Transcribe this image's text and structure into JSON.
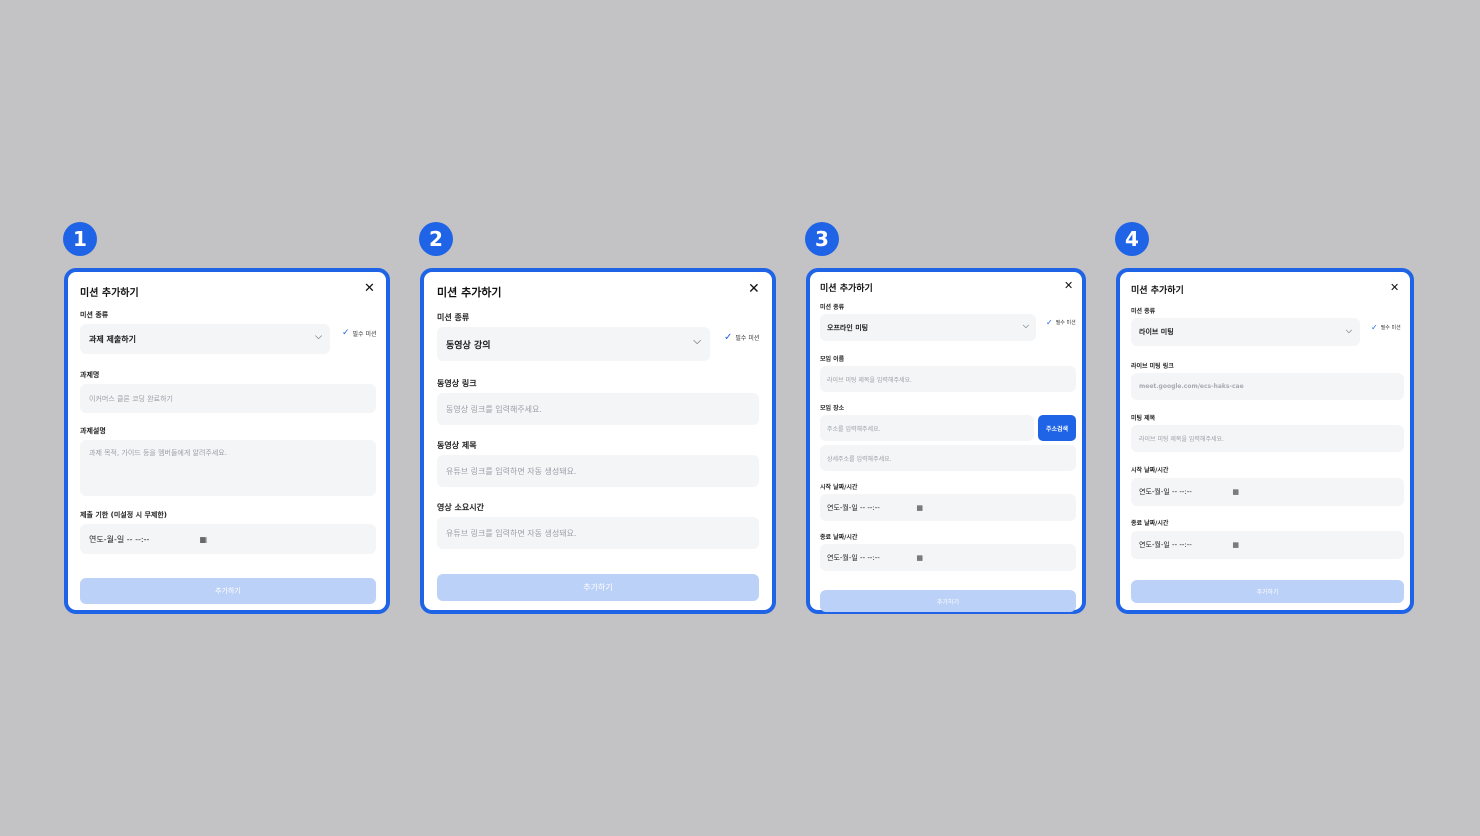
{
  "colors": {
    "accent": "#1f63e6",
    "button_disabled": "#bcd1f7",
    "field_bg": "#f4f5f7",
    "canvas": "#c3c3c5"
  },
  "common": {
    "title": "미션 추가하기",
    "mission_type_label": "미션 종류",
    "required_label": "필수 미션",
    "add_button": "추가하기",
    "datetime_value": "연도-월-일 -- --:--",
    "close_icon": "close-icon",
    "calendar_icon": "calendar-icon"
  },
  "panels": [
    {
      "number": "1",
      "mission_type": "과제 제출하기",
      "fields": [
        {
          "label": "과제명",
          "placeholder": "이커머스 클론 코딩 완료하기"
        },
        {
          "label": "과제설명",
          "placeholder": "과제 목적, 가이드 등을 멤버들에게 알려주세요."
        },
        {
          "label": "제출 기한 (미설정 시 무제한)"
        }
      ]
    },
    {
      "number": "2",
      "mission_type": "동영상 강의",
      "fields": [
        {
          "label": "동영상 링크",
          "placeholder": "동영상 링크를 입력해주세요."
        },
        {
          "label": "동영상 제목",
          "placeholder": "유튜브 링크를 입력하면 자동 생성돼요."
        },
        {
          "label": "영상 소요시간",
          "placeholder": "유튜브 링크를 입력하면 자동 생성돼요."
        }
      ]
    },
    {
      "number": "3",
      "mission_type": "오프라인 미팅",
      "fields": [
        {
          "label": "모임 이름",
          "placeholder": "라이브 미팅 제목을 입력해주세요."
        },
        {
          "label": "모임 장소",
          "placeholder": "주소를 입력해주세요.",
          "button": "주소검색",
          "placeholder2": "상세주소를 입력해주세요."
        },
        {
          "label": "시작 날짜/시간"
        },
        {
          "label": "종료 날짜/시간"
        }
      ]
    },
    {
      "number": "4",
      "mission_type": "라이브 미팅",
      "fields": [
        {
          "label": "라이브 미팅 링크",
          "placeholder": "meet.google.com/ecs-haks-cae"
        },
        {
          "label": "미팅 제목",
          "placeholder": "라이브 미팅 제목을 입력해주세요."
        },
        {
          "label": "시작 날짜/시간"
        },
        {
          "label": "종료 날짜/시간"
        }
      ]
    }
  ]
}
